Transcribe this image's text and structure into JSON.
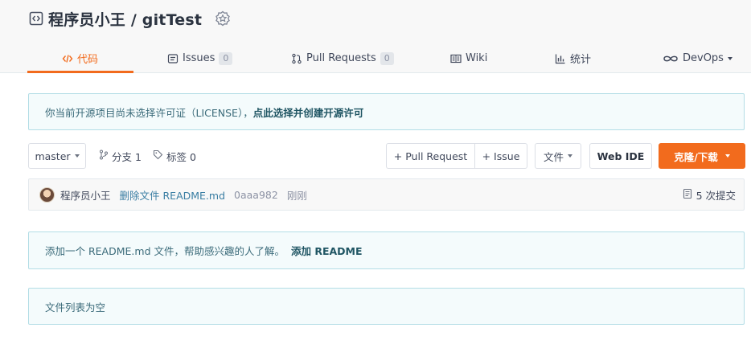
{
  "repo": {
    "owner": "程序员小王",
    "separator": " / ",
    "name": "gitTest"
  },
  "tabs": [
    {
      "label": "代码",
      "icon": "code-icon",
      "active": true
    },
    {
      "label": "Issues",
      "icon": "issues-icon",
      "count": "0"
    },
    {
      "label": "Pull Requests",
      "icon": "pull-request-icon",
      "count": "0"
    },
    {
      "label": "Wiki",
      "icon": "wiki-icon"
    },
    {
      "label": "统计",
      "icon": "chart-icon"
    },
    {
      "label": "DevOps",
      "icon": "devops-icon",
      "dropdown": true
    }
  ],
  "license_notice": {
    "text": "你当前开源项目尚未选择许可证（LICENSE），",
    "link": "点此选择并创建开源许可"
  },
  "toolbar": {
    "branch": "master",
    "branches_label": "分支 1",
    "tags_label": "标签 0",
    "pull_request_button": "+ Pull Request",
    "issue_button": "+ Issue",
    "file_button": "文件",
    "web_ide_button": "Web IDE",
    "clone_button": "克隆/下载"
  },
  "commit": {
    "author": "程序员小王",
    "message": "删除文件 README.md",
    "hash": "0aaa982",
    "time": "刚刚",
    "count_label": "5 次提交"
  },
  "readme_notice": {
    "text": "添加一个 README.md 文件，帮助感兴趣的人了解。",
    "link": "添加 README"
  },
  "empty_notice": {
    "text": "文件列表为空"
  },
  "colors": {
    "accent": "#f26b1d",
    "notice_bg": "#f4fbfc",
    "notice_border": "#b3dde6",
    "link": "#3a7ea3"
  }
}
